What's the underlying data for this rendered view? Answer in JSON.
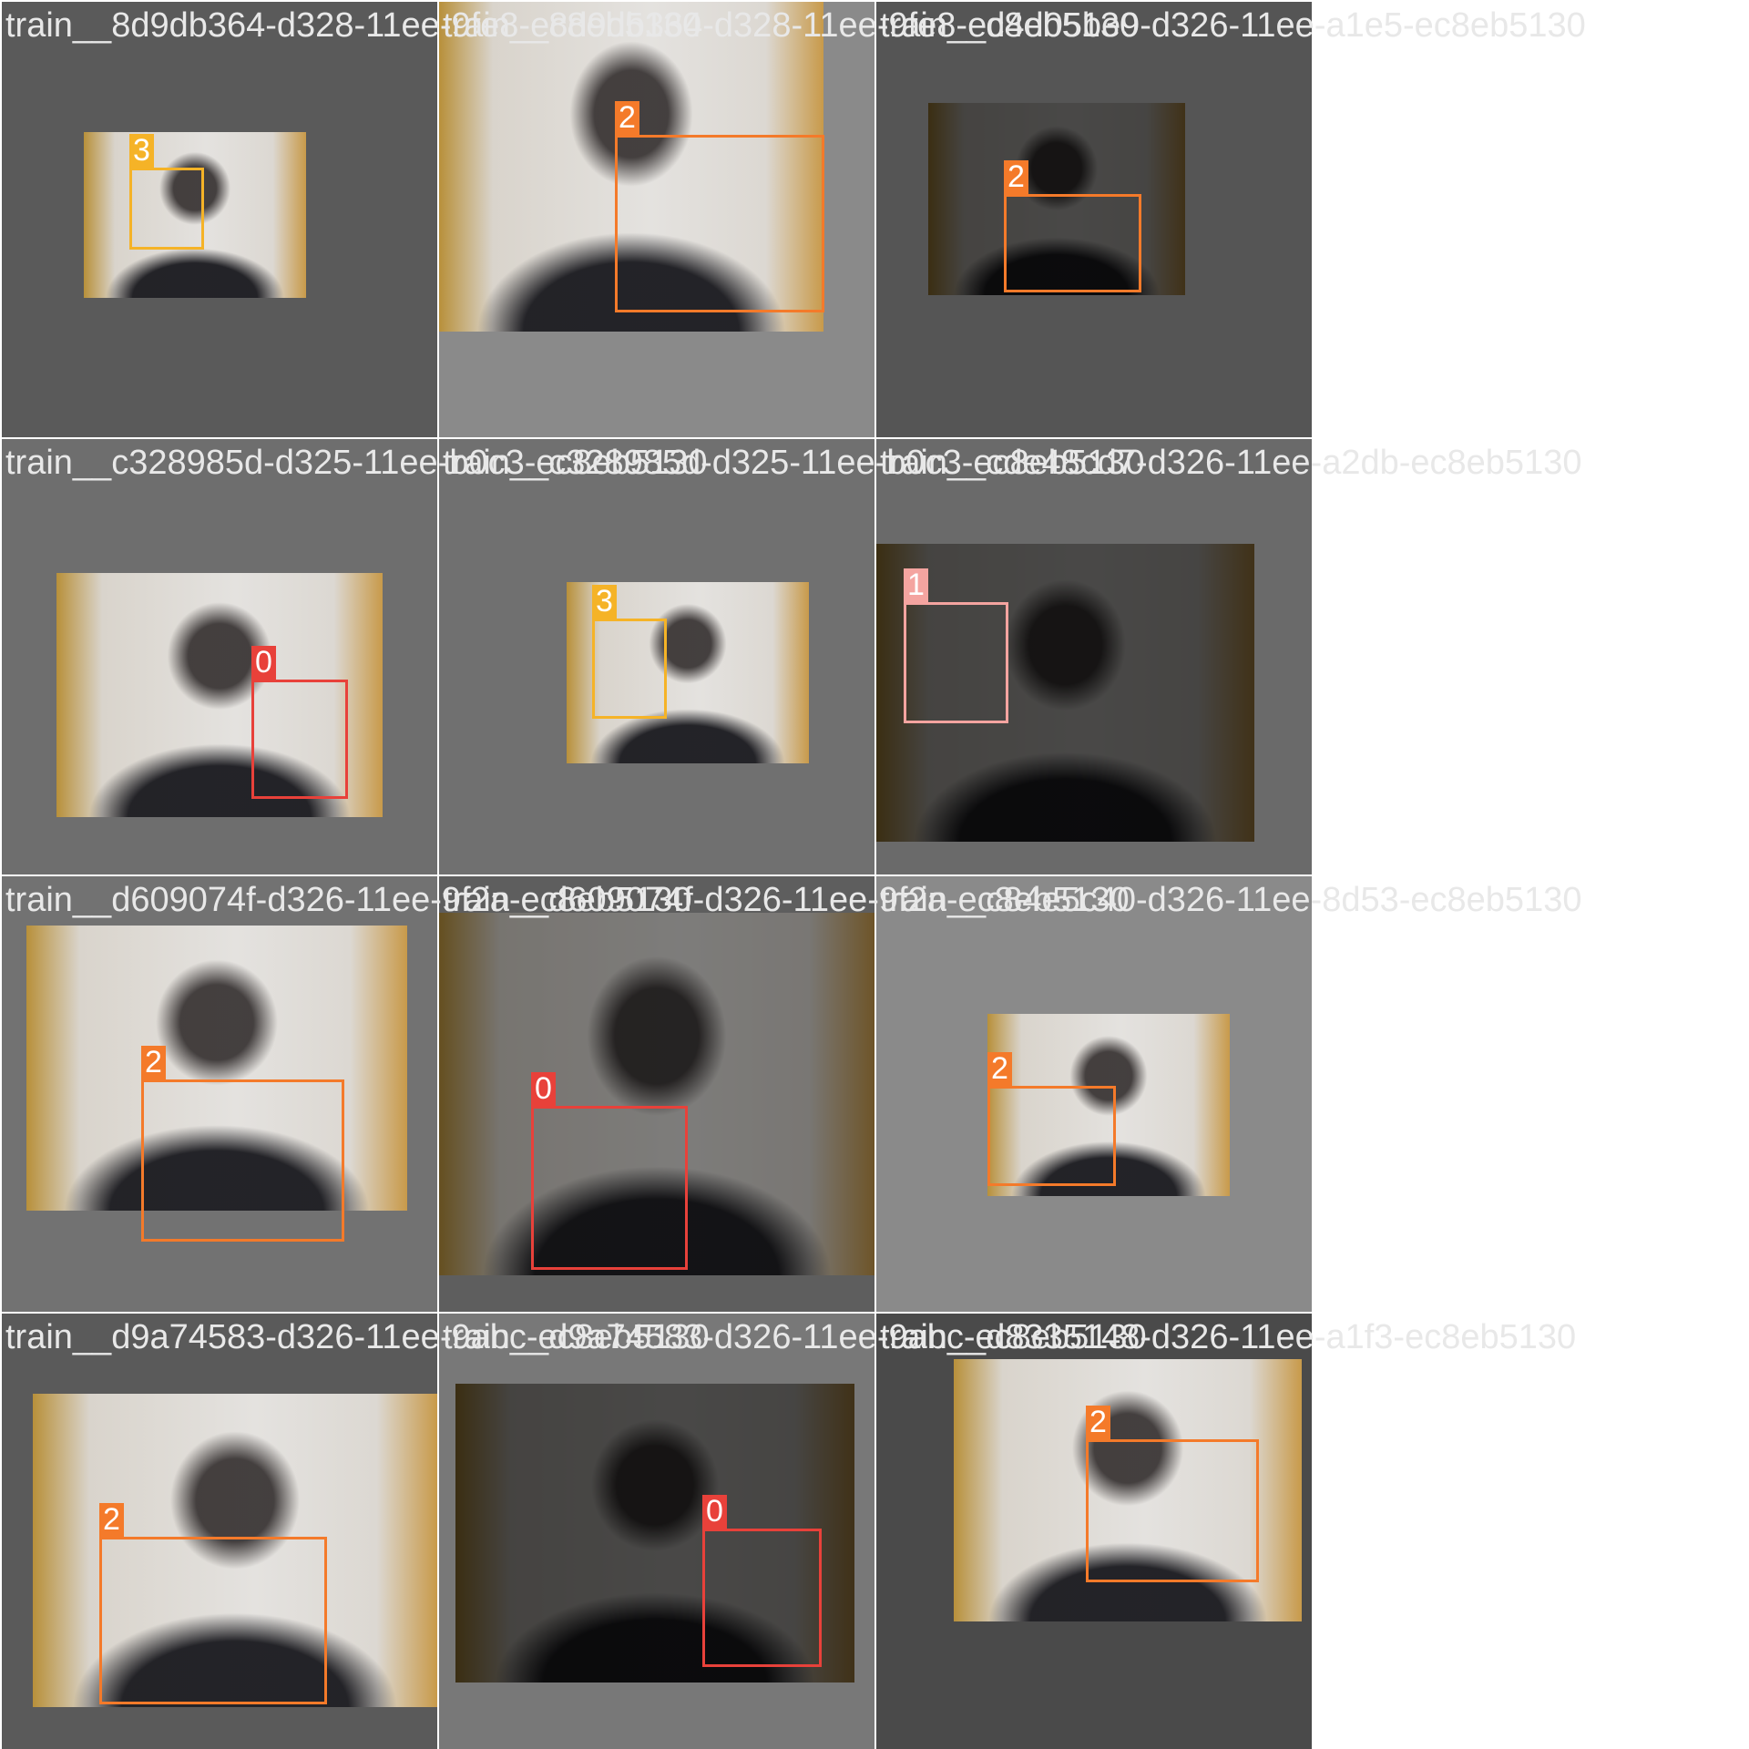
{
  "class_colors": {
    "0": "#e8413a",
    "1": "#f4a4a0",
    "2": "#f47a2a",
    "3": "#f5b327"
  },
  "tiles": [
    {
      "filename": "train__8d9db364-d328-11ee-9fe8-ec8eb5130",
      "background": "#5a5a5a",
      "photo_tone": "normal",
      "boxes": [
        {
          "class_label": "3"
        }
      ]
    },
    {
      "filename": "train__8d9db364-d328-11ee-9fe8-ec8eb5130",
      "background": "#8a8a8a",
      "photo_tone": "normal",
      "boxes": [
        {
          "class_label": "2"
        }
      ]
    },
    {
      "filename": "train__d4d05be9-d326-11ee-a1e5-ec8eb5130",
      "background": "#555555",
      "photo_tone": "dark",
      "boxes": [
        {
          "class_label": "2"
        }
      ]
    },
    {
      "filename": "train__c328985d-d325-11ee-b0c3-ec8eb5130",
      "background": "#6e6e6e",
      "photo_tone": "normal",
      "boxes": [
        {
          "class_label": "0"
        }
      ]
    },
    {
      "filename": "train__c328985d-d325-11ee-b0c3-ec8eb5130",
      "background": "#707070",
      "photo_tone": "normal",
      "boxes": [
        {
          "class_label": "3"
        }
      ]
    },
    {
      "filename": "train__cde48cd7-d326-11ee-a2db-ec8eb5130",
      "background": "#6a6a6a",
      "photo_tone": "dark",
      "boxes": [
        {
          "class_label": "1"
        }
      ]
    },
    {
      "filename": "train__d609074f-d326-11ee-9f2a-ec8eb5130",
      "background": "#727272",
      "photo_tone": "normal",
      "boxes": [
        {
          "class_label": "2"
        }
      ]
    },
    {
      "filename": "train__d609074f-d326-11ee-9f2a-ec8eb5130",
      "background": "#5e5e5e",
      "photo_tone": "dim",
      "boxes": [
        {
          "class_label": "0"
        }
      ]
    },
    {
      "filename": "train__c84e5c40-d326-11ee-8d53-ec8eb5130",
      "background": "#8a8a8a",
      "photo_tone": "normal",
      "boxes": [
        {
          "class_label": "2"
        }
      ]
    },
    {
      "filename": "train__d9a74583-d326-11ee-9abc-ec8eb5130",
      "background": "#5a5a5a",
      "photo_tone": "normal",
      "boxes": [
        {
          "class_label": "2"
        }
      ]
    },
    {
      "filename": "train__d9a74583-d326-11ee-9abc-ec8eb5130",
      "background": "#787878",
      "photo_tone": "dark",
      "boxes": [
        {
          "class_label": "0"
        }
      ]
    },
    {
      "filename": "train__d8335148-d326-11ee-a1f3-ec8eb5130",
      "background": "#4a4a4a",
      "photo_tone": "normal",
      "boxes": [
        {
          "class_label": "2"
        }
      ]
    }
  ]
}
